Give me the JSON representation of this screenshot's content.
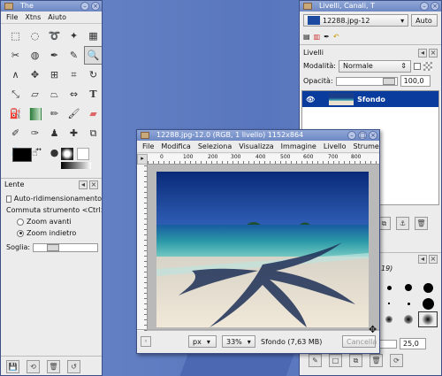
{
  "toolbox": {
    "title": "The",
    "menu": [
      "File",
      "Xtns",
      "Aiuto"
    ],
    "tools": [
      "rect-select",
      "ellipse-select",
      "free-select",
      "fuzzy-select",
      "select-by-color",
      "scissors",
      "foreground-select",
      "paths",
      "color-picker",
      "zoom",
      "measure",
      "move",
      "align",
      "crop",
      "rotate",
      "scale",
      "shear",
      "perspective",
      "flip",
      "text",
      "bucket-fill",
      "blend",
      "pencil",
      "paintbrush",
      "eraser",
      "airbrush",
      "ink",
      "clone",
      "heal",
      "perspective-clone",
      "blur",
      "smudge",
      "dodge-burn"
    ],
    "options": {
      "title": "Lente",
      "auto_resize": "Auto-ridimensionamento",
      "toggle": "Commuta strumento <Ctrl>",
      "zoom_in": "Zoom avanti",
      "zoom_out": "Zoom indietro",
      "threshold": "Soglia:",
      "threshold_value": 0.25
    }
  },
  "layers": {
    "title": "Livelli, Canali, T",
    "image": "12288.jpg-12",
    "auto": "Auto",
    "section": "Livelli",
    "mode_label": "Modalità:",
    "mode_value": "Normale",
    "opacity_label": "Opacità:",
    "opacity_value": "100,0",
    "layer_name": "Sfondo",
    "brush_size_tail": "19)",
    "spacing_value": "25,0",
    "colors": {
      "selection": "#0a3c9e"
    }
  },
  "image_window": {
    "title": "12288.jpg-12.0 (RGB, 1 livello) 1152x864",
    "menu": [
      "File",
      "Modifica",
      "Seleziona",
      "Visualizza",
      "Immagine",
      "Livello",
      "Strumenti"
    ],
    "ruler_labels": [
      "0",
      "100",
      "200",
      "300",
      "400",
      "500",
      "600",
      "700",
      "800"
    ],
    "unit": "px",
    "zoom": "33%",
    "status": "Sfondo (7,63 MB)",
    "cancel": "Cancella"
  }
}
